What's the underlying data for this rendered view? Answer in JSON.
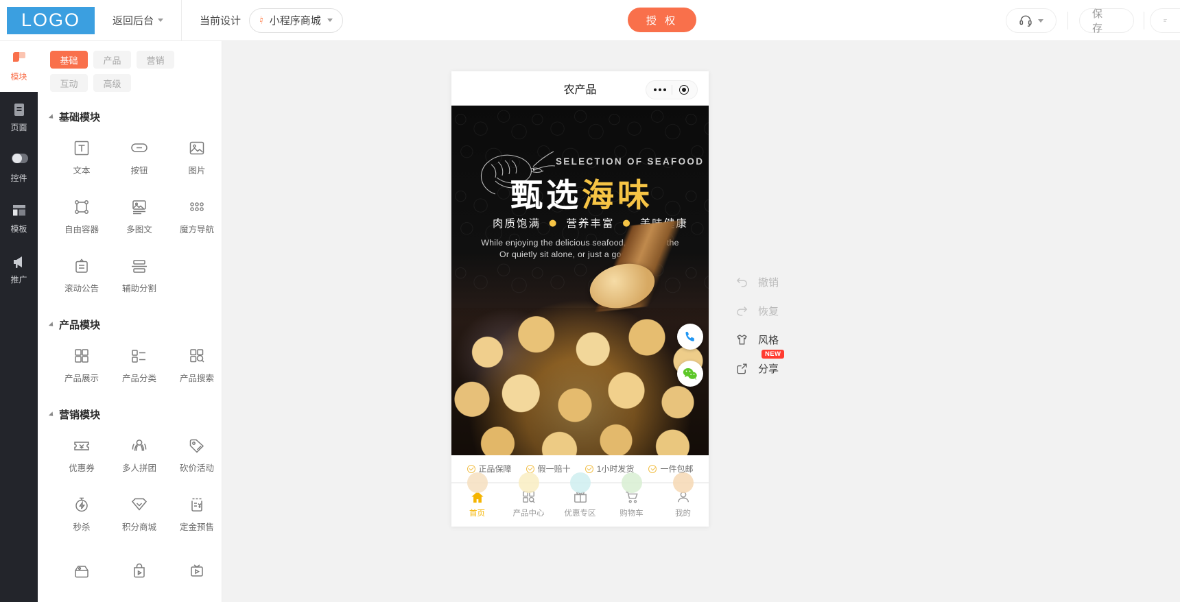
{
  "topbar": {
    "logo": "LOGO",
    "back_label": "返回后台",
    "current_design_label": "当前设计",
    "design_name": "小程序商城",
    "auth_button": "授 权",
    "save_button": "保 存"
  },
  "rail": {
    "items": [
      {
        "label": "模块",
        "icon": "modules-icon",
        "active": true
      },
      {
        "label": "页面",
        "icon": "page-icon",
        "active": false
      },
      {
        "label": "控件",
        "icon": "widget-toggle-icon",
        "active": false
      },
      {
        "label": "模板",
        "icon": "template-icon",
        "active": false
      },
      {
        "label": "推广",
        "icon": "megaphone-icon",
        "active": false
      }
    ]
  },
  "panel": {
    "categories": [
      {
        "label": "基础",
        "active": true
      },
      {
        "label": "产品",
        "active": false
      },
      {
        "label": "营销",
        "active": false
      },
      {
        "label": "互动",
        "active": false
      },
      {
        "label": "高级",
        "active": false
      }
    ],
    "sections": [
      {
        "title": "基础模块",
        "modules": [
          {
            "label": "文本",
            "icon": "text-icon"
          },
          {
            "label": "按钮",
            "icon": "button-icon"
          },
          {
            "label": "图片",
            "icon": "image-icon"
          },
          {
            "label": "自由容器",
            "icon": "free-container-icon"
          },
          {
            "label": "多图文",
            "icon": "multi-image-text-icon"
          },
          {
            "label": "魔方导航",
            "icon": "cube-nav-icon"
          },
          {
            "label": "滚动公告",
            "icon": "announcement-icon"
          },
          {
            "label": "辅助分割",
            "icon": "divider-icon"
          }
        ]
      },
      {
        "title": "产品模块",
        "modules": [
          {
            "label": "产品展示",
            "icon": "product-grid-icon"
          },
          {
            "label": "产品分类",
            "icon": "product-category-icon"
          },
          {
            "label": "产品搜索",
            "icon": "product-search-icon"
          }
        ]
      },
      {
        "title": "营销模块",
        "modules": [
          {
            "label": "优惠券",
            "icon": "coupon-icon"
          },
          {
            "label": "多人拼团",
            "icon": "group-buy-icon"
          },
          {
            "label": "砍价活动",
            "icon": "bargain-icon"
          },
          {
            "label": "秒杀",
            "icon": "flash-sale-icon"
          },
          {
            "label": "积分商城",
            "icon": "points-mall-icon"
          },
          {
            "label": "定金预售",
            "icon": "presale-icon"
          },
          {
            "label": "",
            "icon": "gift-box-icon"
          },
          {
            "label": "",
            "icon": "bag-play-icon"
          },
          {
            "label": "",
            "icon": "live-play-icon"
          }
        ]
      }
    ]
  },
  "preview": {
    "page_title": "农产品",
    "capsule": {
      "more": "more-dots-icon",
      "target": "target-circle-icon"
    },
    "banner": {
      "english_line": "SELECTION OF SEAFOOD",
      "headline_white": "甄选",
      "headline_yellow": "海味",
      "features": [
        "肉质饱满",
        "营养丰富",
        "美味健康"
      ],
      "bullet": "●",
      "description_line1": "While enjoying the delicious seafood, looked at the",
      "description_line2": "Or quietly sit alone, or just a good friend ."
    },
    "floating": [
      {
        "name": "call-fab",
        "icon": "phone-icon"
      },
      {
        "name": "wechat-fab",
        "icon": "wechat-icon"
      }
    ],
    "guarantees": [
      "正品保障",
      "假一赔十",
      "1小时发货",
      "一件包邮"
    ],
    "tabbar": [
      {
        "label": "首页",
        "icon": "home-icon",
        "active": true
      },
      {
        "label": "产品中心",
        "icon": "product-center-icon",
        "active": false
      },
      {
        "label": "优惠专区",
        "icon": "gift-icon",
        "active": false
      },
      {
        "label": "购物车",
        "icon": "cart-icon",
        "active": false
      },
      {
        "label": "我的",
        "icon": "user-icon",
        "active": false
      }
    ]
  },
  "tools": [
    {
      "label": "撤销",
      "icon": "undo-icon",
      "disabled": true,
      "badge": ""
    },
    {
      "label": "恢复",
      "icon": "redo-icon",
      "disabled": true,
      "badge": ""
    },
    {
      "label": "风格",
      "icon": "shirt-icon",
      "disabled": false,
      "badge": ""
    },
    {
      "label": "分享",
      "icon": "share-icon",
      "disabled": false,
      "badge": "NEW"
    }
  ],
  "colors": {
    "accent": "#f9704b",
    "logo_blue": "#3b9fe0",
    "rail_bg": "#23252b",
    "tab_active": "#f5b400",
    "badge_red": "#ff3b30"
  }
}
